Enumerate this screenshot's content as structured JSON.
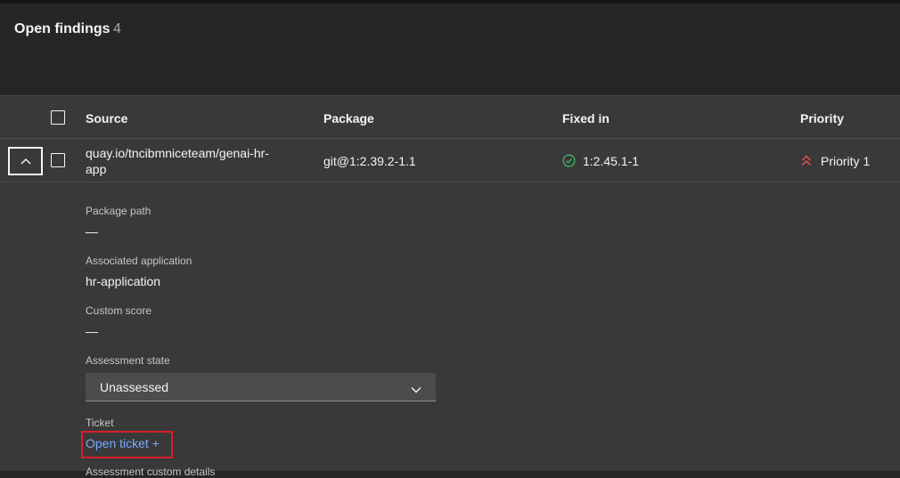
{
  "header": {
    "title": "Open findings",
    "count": "4"
  },
  "table": {
    "columns": {
      "source": "Source",
      "package": "Package",
      "fixed_in": "Fixed in",
      "priority": "Priority"
    },
    "rows": [
      {
        "source_line1": "quay.io/tncibmniceteam/genai-hr-",
        "source_line2": "app",
        "package": "git@1:2.39.2-1.1",
        "fixed_in": "1:2.45.1-1",
        "priority": "Priority 1"
      }
    ]
  },
  "details": {
    "package_path_label": "Package path",
    "package_path_value": "—",
    "associated_app_label": "Associated application",
    "associated_app_value": "hr-application",
    "custom_score_label": "Custom score",
    "custom_score_value": "—",
    "assessment_state_label": "Assessment state",
    "assessment_state_value": "Unassessed",
    "ticket_label": "Ticket",
    "open_ticket_link": "Open ticket +",
    "next_label": "Assessment custom details"
  },
  "colors": {
    "priority_icon": "#fa4d56",
    "fixed_icon": "#42be65",
    "link": "#78a9ff",
    "highlight_box": "#da1e28"
  },
  "icons": {
    "expand": "chevron-up-icon",
    "dropdown": "chevron-down-icon",
    "fixed": "checkmark-outline-icon",
    "priority": "double-chevron-up-icon"
  }
}
